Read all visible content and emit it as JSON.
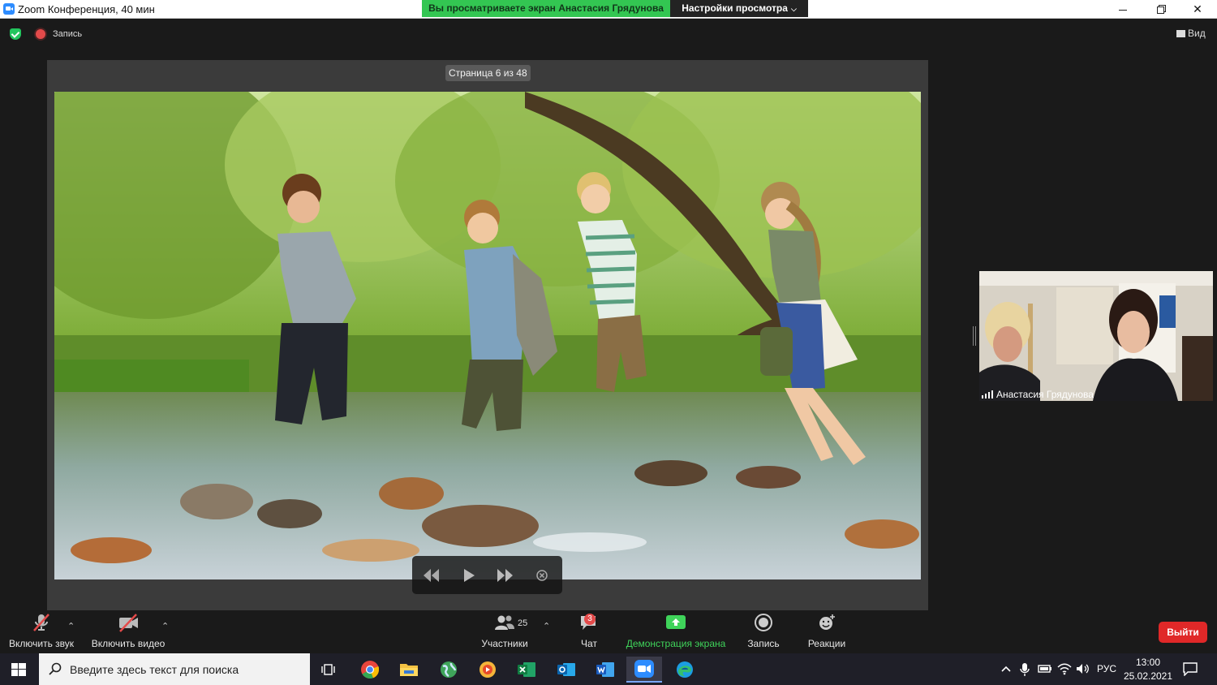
{
  "window": {
    "title": "Zoom Конференция, 40 мин",
    "sharing_banner": "Вы просматриваете экран Анастасия Грядунова",
    "view_settings_label": "Настройки просмотра"
  },
  "meeting_bar": {
    "recording_label": "Запись",
    "view_label": "Вид"
  },
  "share": {
    "page_indicator": "Страница 6 из 48"
  },
  "participant": {
    "name": "Анастасия Грядунова"
  },
  "toolbar": {
    "unmute_label": "Включить звук",
    "start_video_label": "Включить видео",
    "participants_label": "Участники",
    "participants_count": "25",
    "chat_label": "Чат",
    "chat_badge": "3",
    "share_label": "Демонстрация экрана",
    "record_label": "Запись",
    "reactions_label": "Реакции",
    "leave_label": "Выйти"
  },
  "taskbar": {
    "search_placeholder": "Введите здесь текст для поиска",
    "language": "РУС",
    "time": "13:00",
    "date": "25.02.2021"
  },
  "colors": {
    "banner_green": "#33c652",
    "share_green": "#3fd35a",
    "leave_red": "#e02828",
    "zoom_blue": "#2d8cff"
  }
}
